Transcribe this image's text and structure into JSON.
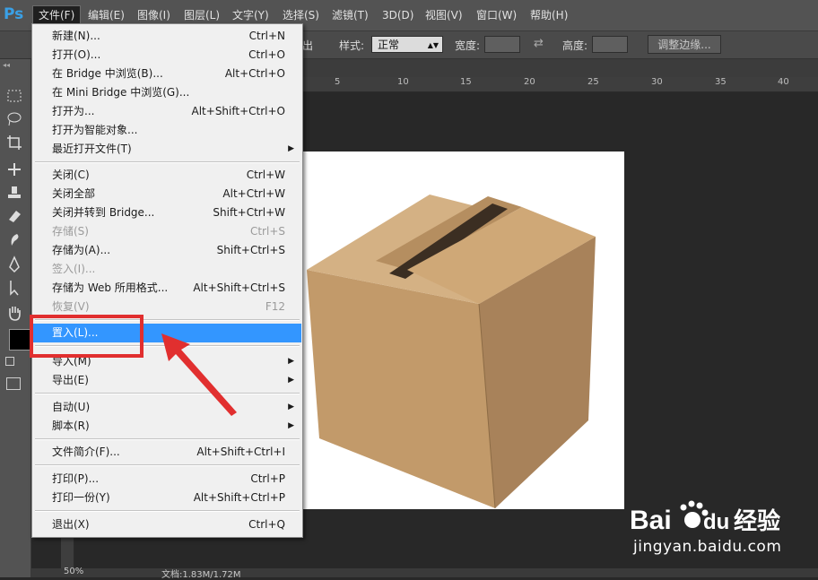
{
  "app": {
    "logo": "Ps"
  },
  "menubar": {
    "items": [
      {
        "label": "文件(F)"
      },
      {
        "label": "编辑(E)"
      },
      {
        "label": "图像(I)"
      },
      {
        "label": "图层(L)"
      },
      {
        "label": "文字(Y)"
      },
      {
        "label": "选择(S)"
      },
      {
        "label": "滤镜(T)"
      },
      {
        "label": "3D(D)"
      },
      {
        "label": "视图(V)"
      },
      {
        "label": "窗口(W)"
      },
      {
        "label": "帮助(H)"
      }
    ]
  },
  "options": {
    "partial_label": "出",
    "style_label": "样式:",
    "style_value": "正常",
    "width_label": "宽度:",
    "height_label": "高度:",
    "refine_button": "调整边缘..."
  },
  "ruler": {
    "ticks": [
      "5",
      "10",
      "15",
      "20",
      "25",
      "30",
      "35",
      "40"
    ]
  },
  "status": {
    "zoom": "50%",
    "doc": "文档:1.83M/1.72M"
  },
  "file_menu": {
    "items": [
      {
        "label": "新建(N)...",
        "shortcut": "Ctrl+N"
      },
      {
        "label": "打开(O)...",
        "shortcut": "Ctrl+O"
      },
      {
        "label": "在 Bridge 中浏览(B)...",
        "shortcut": "Alt+Ctrl+O"
      },
      {
        "label": "在 Mini Bridge 中浏览(G)...",
        "shortcut": ""
      },
      {
        "label": "打开为...",
        "shortcut": "Alt+Shift+Ctrl+O"
      },
      {
        "label": "打开为智能对象...",
        "shortcut": ""
      },
      {
        "label": "最近打开文件(T)",
        "shortcut": ""
      },
      {
        "label": "关闭(C)",
        "shortcut": "Ctrl+W"
      },
      {
        "label": "关闭全部",
        "shortcut": "Alt+Ctrl+W"
      },
      {
        "label": "关闭并转到 Bridge...",
        "shortcut": "Shift+Ctrl+W"
      },
      {
        "label": "存储(S)",
        "shortcut": "Ctrl+S"
      },
      {
        "label": "存储为(A)...",
        "shortcut": "Shift+Ctrl+S"
      },
      {
        "label": "签入(I)...",
        "shortcut": ""
      },
      {
        "label": "存储为 Web 所用格式...",
        "shortcut": "Alt+Shift+Ctrl+S"
      },
      {
        "label": "恢复(V)",
        "shortcut": "F12"
      },
      {
        "label": "置入(L)...",
        "shortcut": ""
      },
      {
        "label": "导入(M)",
        "shortcut": ""
      },
      {
        "label": "导出(E)",
        "shortcut": ""
      },
      {
        "label": "自动(U)",
        "shortcut": ""
      },
      {
        "label": "脚本(R)",
        "shortcut": ""
      },
      {
        "label": "文件简介(F)...",
        "shortcut": "Alt+Shift+Ctrl+I"
      },
      {
        "label": "打印(P)...",
        "shortcut": "Ctrl+P"
      },
      {
        "label": "打印一份(Y)",
        "shortcut": "Alt+Shift+Ctrl+P"
      },
      {
        "label": "退出(X)",
        "shortcut": "Ctrl+Q"
      }
    ]
  },
  "watermark": {
    "brand": "Bai du 经验",
    "url": "jingyan.baidu.com"
  },
  "colors": {
    "highlight": "#3396ff",
    "annotation_red": "#e12f2f",
    "ps_blue": "#3aa0e6"
  }
}
